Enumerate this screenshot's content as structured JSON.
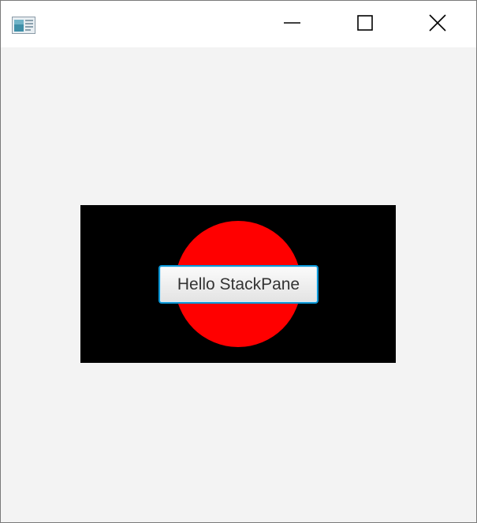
{
  "window": {
    "icon": "java-app-icon",
    "controls": {
      "minimize_icon": "minimize-icon",
      "maximize_icon": "maximize-icon",
      "close_icon": "close-icon"
    }
  },
  "content": {
    "background_color": "#f3f3f3",
    "rectangle_color": "#000000",
    "circle_color": "#ff0000",
    "button": {
      "label": "Hello StackPane",
      "focus_color": "#0a96d6"
    }
  }
}
